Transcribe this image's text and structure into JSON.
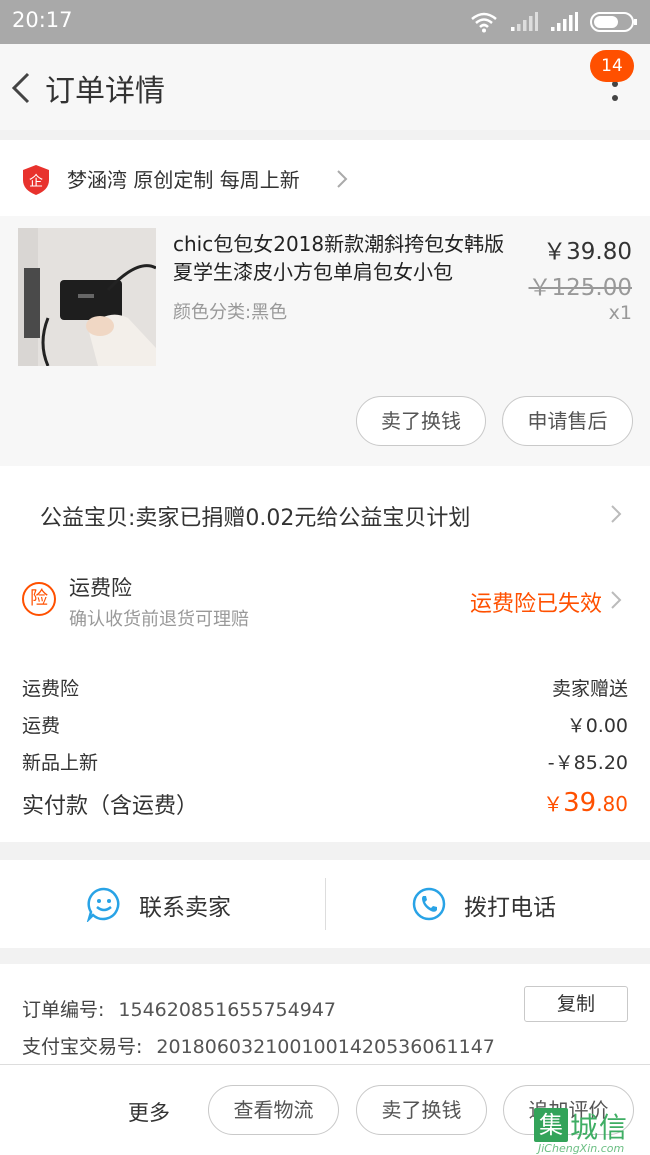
{
  "status_bar": {
    "time": "20:17"
  },
  "nav": {
    "title": "订单详情",
    "badge_count": "14"
  },
  "shop": {
    "name": "梦涵湾 原创定制 每周上新"
  },
  "product": {
    "title": "chic包包女2018新款潮斜挎包女韩版夏学生漆皮小方包单肩包女小包",
    "sku": "颜色分类:黑色",
    "price": "￥39.80",
    "original_price": "￥125.00",
    "quantity": "x1",
    "sell_button": "卖了换钱",
    "after_sales_button": "申请售后"
  },
  "charity": {
    "text": "公益宝贝:卖家已捐赠0.02元给公益宝贝计划"
  },
  "insurance": {
    "icon_char": "险",
    "title": "运费险",
    "subtitle": "确认收货前退货可理赔",
    "status": "运费险已失效",
    "status_color": "#ff5000"
  },
  "fees": {
    "rows": [
      {
        "label": "运费险",
        "value": "卖家赠送"
      },
      {
        "label": "运费",
        "value": "￥0.00"
      },
      {
        "label": "新品上新",
        "value": "-￥85.20"
      }
    ],
    "total_label": "实付款（含运费）",
    "total_currency": "￥",
    "total_integer": "39",
    "total_decimal": ".80"
  },
  "contact": {
    "seller_label": "联系卖家",
    "phone_label": "拨打电话",
    "accent_color": "#29a3e6"
  },
  "order_info": {
    "order_no_label": "订单编号:",
    "order_no": "154620851655754947",
    "alipay_label": "支付宝交易号:",
    "alipay_no": "2018060321001001420536061147",
    "copy_button": "复制"
  },
  "bottom_bar": {
    "more_label": "更多",
    "buttons": [
      "查看物流",
      "卖了换钱",
      "追加评价"
    ]
  },
  "watermark": {
    "logo_char": "集",
    "cn": "城信",
    "en": "JiChengXin.com"
  }
}
